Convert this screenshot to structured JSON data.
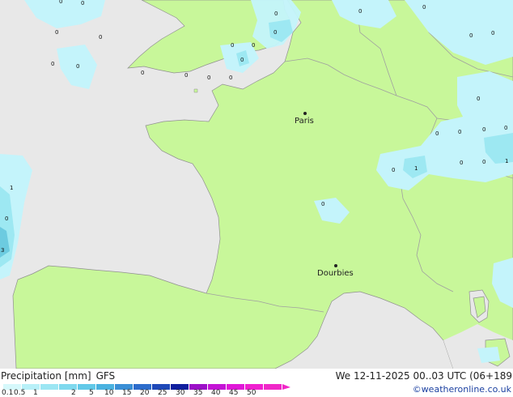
{
  "map": {
    "cities": [
      {
        "name": "Paris"
      },
      {
        "name": "Dourbies"
      }
    ],
    "grid_values": [
      "0",
      "0",
      "0",
      "0",
      "0",
      "0",
      "0",
      "0",
      "0",
      "0",
      "0",
      "0",
      "0",
      "0",
      "0",
      "0",
      "0",
      "0",
      "0",
      "0",
      "0",
      "0",
      "0",
      "0",
      "0",
      "1",
      "0",
      "0",
      "1",
      "1",
      "0",
      "0",
      "3"
    ],
    "colors": {
      "land": "#c8f79a",
      "sea": "#e8e8e8",
      "precip_light": "#c4f4fb",
      "precip_medium": "#9de8f2",
      "precip_strong": "#6ccbe0",
      "border": "#a0a0a0",
      "coast": "#909090"
    }
  },
  "legend": {
    "title": "Precipitation [mm]",
    "model": "GFS",
    "datetime": "We 12-11-2025 00..03 UTC (06+189",
    "credit": "©weatheronline.co.uk",
    "ticks": [
      "0.1",
      "0.5",
      "1",
      "2",
      "5",
      "10",
      "15",
      "20",
      "25",
      "30",
      "35",
      "40",
      "45",
      "50"
    ],
    "scale_colors": [
      "#d6f8fb",
      "#b8f0f8",
      "#9ce6f3",
      "#7fd9ee",
      "#62c9e8",
      "#4ab2e0",
      "#3a8fd6",
      "#2d6ccb",
      "#1f49b8",
      "#101f9e",
      "#9c10c8",
      "#c414d6",
      "#e018d8",
      "#f020d0",
      "#f028c8"
    ]
  }
}
